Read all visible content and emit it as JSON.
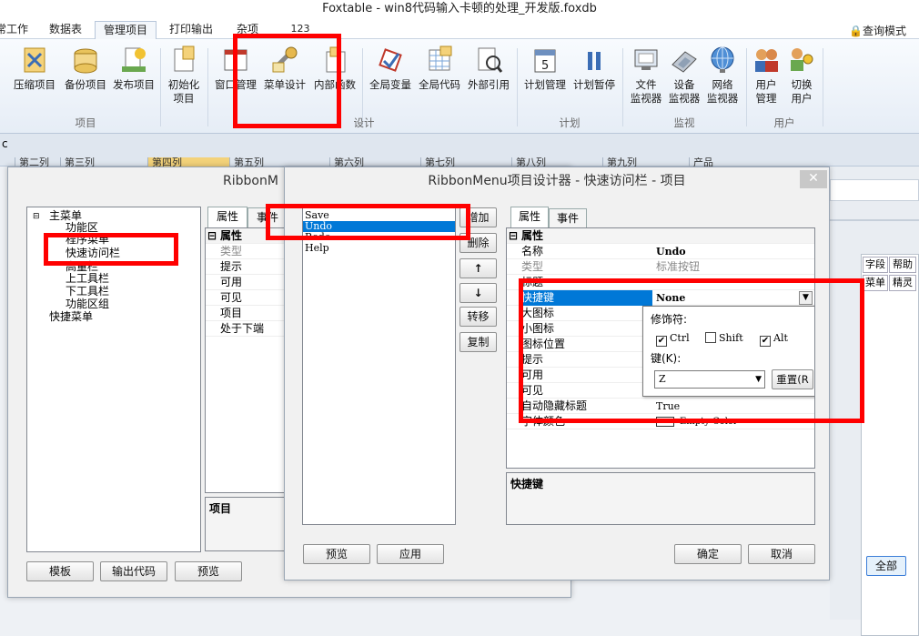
{
  "window": {
    "title": "Foxtable - win8代码输入卡顿的处理_开发版.foxdb"
  },
  "tabs": [
    "常工作",
    "数据表",
    "管理项目",
    "打印输出",
    "杂项",
    "123"
  ],
  "ribbon": {
    "query_mode": "查询模式",
    "buttons": {
      "compress": "压缩项目",
      "backup": "备份项目",
      "publish": "发布项目",
      "init_1": "初始化",
      "init_2": "项目",
      "window_mgr": "窗口管理",
      "menu_design": "菜单设计",
      "internal_func": "内部函数",
      "global_var": "全局变量",
      "global_code": "全局代码",
      "external_ref": "外部引用",
      "plan_mgr": "计划管理",
      "plan_pause": "计划暂停",
      "file_mon_1": "文件",
      "file_mon_2": "监视器",
      "device_mon_1": "设备",
      "device_mon_2": "监视器",
      "net_mon_1": "网络",
      "net_mon_2": "监视器",
      "user_mgr_1": "用户",
      "user_mgr_2": "管理",
      "switch_user_1": "切换",
      "switch_user_2": "用户"
    },
    "groups": {
      "project": "项目",
      "design": "设计",
      "plan": "计划",
      "monitor": "监视",
      "user": "用户"
    }
  },
  "strip": {
    "left_char": "c",
    "columns": [
      "第二列",
      "第三列",
      "第四列",
      "第五列",
      "第六列",
      "第七列",
      "第八列",
      "第九列",
      "产品"
    ]
  },
  "right_panel": {
    "tabs": [
      "字段",
      "帮助"
    ],
    "tab2": [
      "菜单",
      "精灵"
    ],
    "all_button": "全部"
  },
  "dialog1": {
    "title": "RibbonM",
    "tree": [
      "主菜单",
      "功能区",
      "程序菜单",
      "快速访问栏",
      "高量栏",
      "上工具栏",
      "下工具栏",
      "功能区组",
      "快捷菜单"
    ],
    "prop_tabs": [
      "属性",
      "事件"
    ],
    "props": [
      "属性",
      "类型",
      "提示",
      "可用",
      "可见",
      "项目",
      "处于下端"
    ],
    "desc": "项目",
    "buttons": {
      "template": "模板",
      "export": "输出代码",
      "preview": "预览"
    }
  },
  "dialog2": {
    "title": "RibbonMenu项目设计器 - 快速访问栏 - 项目",
    "list": [
      "Save",
      "Undo",
      "Redo",
      "Help"
    ],
    "side_buttons": {
      "add": "增加",
      "delete": "删除",
      "up": "↑",
      "down": "↓",
      "move": "转移",
      "copy": "复制"
    },
    "prop_tabs": [
      "属性",
      "事件"
    ],
    "props": [
      {
        "name": "属性",
        "value": ""
      },
      {
        "name": "名称",
        "value": "Undo"
      },
      {
        "name": "类型",
        "value": "标准按钮"
      },
      {
        "name": "标题",
        "value": ""
      },
      {
        "name": "快捷键",
        "value": "None"
      },
      {
        "name": "大图标",
        "value": ""
      },
      {
        "name": "小图标",
        "value": ""
      },
      {
        "name": "图标位置",
        "value": ""
      },
      {
        "name": "提示",
        "value": ""
      },
      {
        "name": "可用",
        "value": ""
      },
      {
        "name": "可见",
        "value": ""
      },
      {
        "name": "自动隐藏标题",
        "value": "True"
      },
      {
        "name": "字体颜色",
        "value": "Empty Color"
      }
    ],
    "shortcut_popup": {
      "modifiers_label": "修饰符:",
      "ctrl": "Ctrl",
      "ctrl_checked": true,
      "shift": "Shift",
      "shift_checked": false,
      "alt": "Alt",
      "alt_checked": true,
      "key_label": "键(K):",
      "key_value": "Z",
      "reset": "重置(R"
    },
    "desc": "快捷键",
    "buttons": {
      "preview": "预览",
      "apply": "应用",
      "ok": "确定",
      "cancel": "取消"
    }
  },
  "colors": {
    "highlight": "#0078d7",
    "annotation": "#ff0000"
  }
}
